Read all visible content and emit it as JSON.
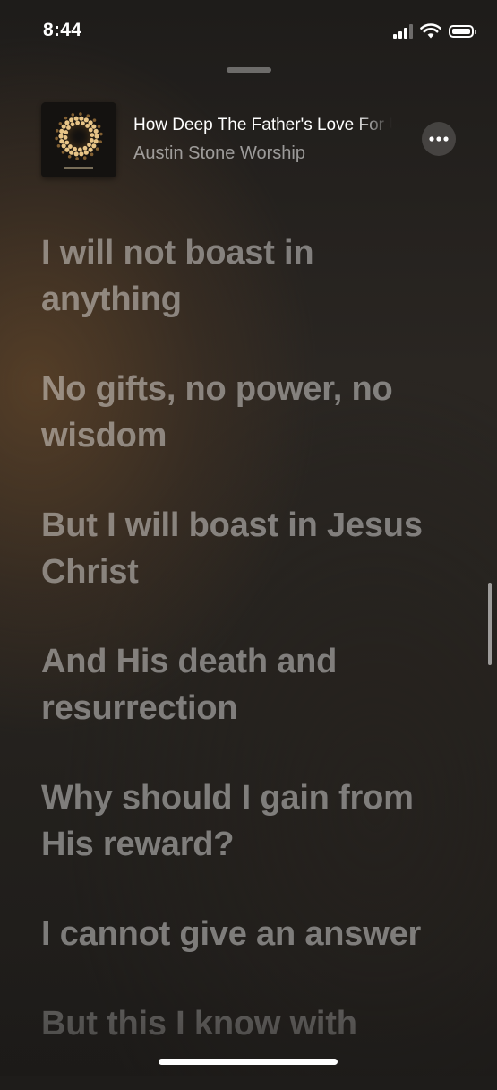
{
  "status_bar": {
    "time": "8:44",
    "icons": [
      "cellular-signal-icon",
      "wifi-icon",
      "battery-icon"
    ]
  },
  "now_playing": {
    "title": "How Deep The Father's Love For Us",
    "artist": "Austin Stone Worship",
    "artwork_icon": "album-artwork-candle-wreath",
    "more_icon": "ellipsis-icon"
  },
  "lyrics": {
    "lines": [
      "I will not boast in anything",
      "No gifts, no power, no wisdom",
      "But I will boast in Jesus Christ",
      "And His death and resurrection",
      "Why should I gain from His reward?",
      "I cannot give an answer",
      "But this I know with"
    ]
  },
  "colors": {
    "background_warm": "#5c4228",
    "background_dark": "#1e1c1a",
    "lyric_text": "#8f8a85",
    "accent_white": "#ffffff"
  }
}
